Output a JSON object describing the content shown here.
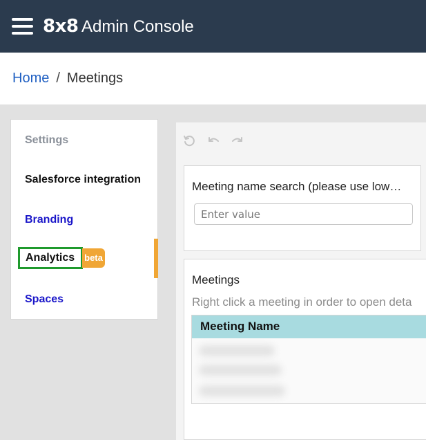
{
  "topbar": {
    "menu_icon": "hamburger-menu-icon",
    "logo_text": "8x8",
    "title": "Admin Console",
    "background_color": "#2b3b4e"
  },
  "breadcrumb": {
    "home": "Home",
    "separator": "/",
    "current": "Meetings"
  },
  "sidebar": {
    "heading": "Settings",
    "items": [
      {
        "label": "Salesforce integration"
      },
      {
        "label": "Branding"
      },
      {
        "label": "Analytics",
        "badge": "beta",
        "active": true
      },
      {
        "label": "Spaces"
      }
    ],
    "link_color": "#1a16c9",
    "active_indicator_color": "#f0a635",
    "highlight_border_color": "#1f9a2d"
  },
  "toolbar": {
    "icons": [
      "refresh-icon",
      "undo-icon",
      "redo-icon"
    ]
  },
  "search": {
    "label": "Meeting name search (please use low…",
    "placeholder": "Enter value",
    "value": ""
  },
  "meetings": {
    "title": "Meetings",
    "hint": "Right click a meeting in order to open deta",
    "columns": [
      "Meeting Name"
    ],
    "header_color": "#a8dbe0"
  }
}
